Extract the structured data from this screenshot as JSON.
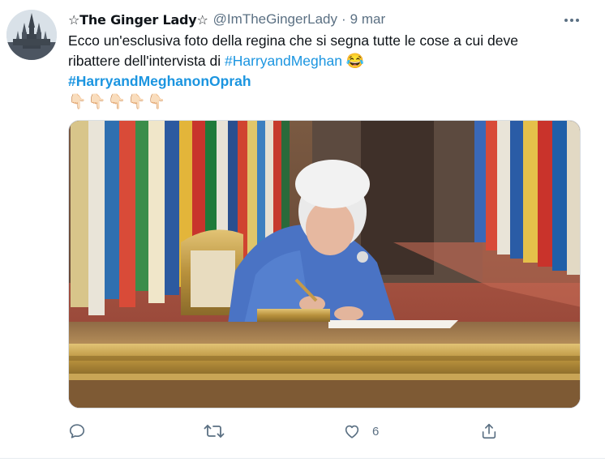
{
  "tweet": {
    "display_name": "☆The Ginger Lady☆",
    "handle": "@ImTheGingerLady",
    "separator": "·",
    "date": "9 mar",
    "text_line1": "Ecco un'esclusiva foto della regina che si segna tutte le cose a cui deve",
    "text_line2_plain": "ribattere dell'intervista di ",
    "hashtag1": "#HarryandMeghan",
    "emoji": "😂",
    "hashtag2": "#HarryandMeghanonOprah",
    "hands": "👇🏻👇🏻👇🏻👇🏻👇🏻",
    "avatar_icon": "castle-avatar",
    "media_alt": "Queen writing at a gilded desk in front of flags"
  },
  "actions": {
    "reply_icon": "reply-icon",
    "retweet_icon": "retweet-icon",
    "like_icon": "like-icon",
    "like_count": "6",
    "share_icon": "share-icon"
  },
  "colors": {
    "link": "#1b95e0",
    "muted": "#5b7083",
    "text": "#0f1419"
  }
}
